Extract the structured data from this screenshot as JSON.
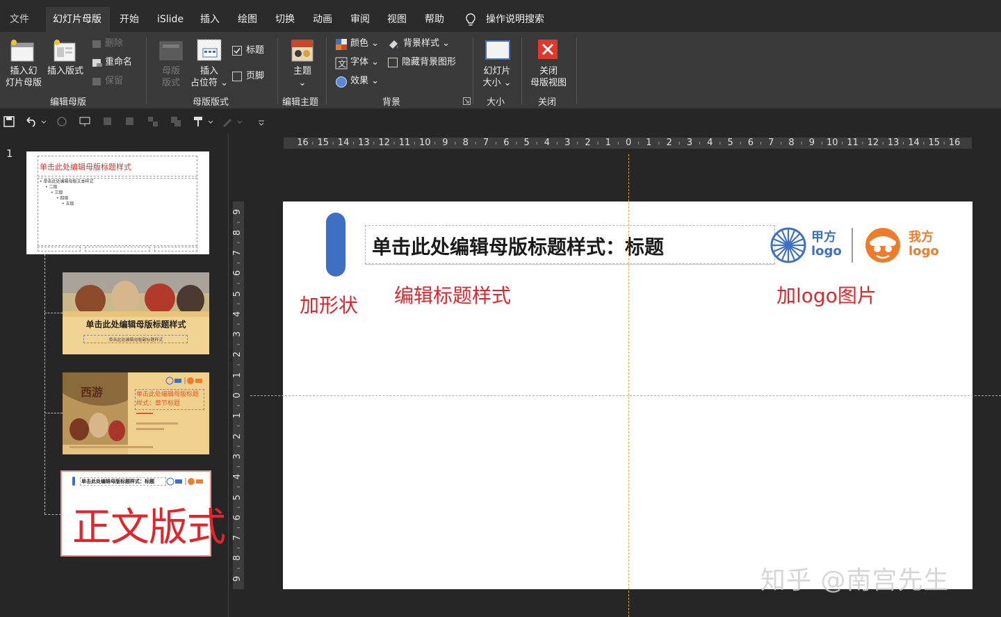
{
  "menu": {
    "tabs": [
      {
        "label": "文件"
      },
      {
        "label": "幻灯片母版"
      },
      {
        "label": "开始"
      },
      {
        "label": "iSlide"
      },
      {
        "label": "插入"
      },
      {
        "label": "绘图"
      },
      {
        "label": "切换"
      },
      {
        "label": "动画"
      },
      {
        "label": "审阅"
      },
      {
        "label": "视图"
      },
      {
        "label": "帮助"
      }
    ],
    "search_label": "操作说明搜索"
  },
  "ribbon": {
    "edit_master": {
      "insert_master_line1": "插入幻",
      "insert_master_line2": "灯片母版",
      "insert_layout": "插入版式",
      "delete": "删除",
      "rename": "重命名",
      "preserve": "保留",
      "group_label": "编辑母版"
    },
    "master_layout": {
      "master_layout_line1": "母版",
      "master_layout_line2": "版式",
      "insert_placeholder_line1": "插入",
      "insert_placeholder_line2": "占位符",
      "title_check": "标题",
      "footer_check": "页脚",
      "group_label": "母版版式"
    },
    "edit_theme": {
      "theme": "主题",
      "group_label": "编辑主题"
    },
    "background": {
      "colors": "颜色",
      "fonts": "字体",
      "effects": "效果",
      "bg_styles": "背景样式",
      "hide_bg": "隐藏背景图形",
      "group_label": "背景"
    },
    "size": {
      "slide_size_line1": "幻灯片",
      "slide_size_line2": "大小",
      "group_label": "大小"
    },
    "close": {
      "close_line1": "关闭",
      "close_line2": "母版视图",
      "group_label": "关闭"
    }
  },
  "thumbnails": {
    "slide_number": "1",
    "master_title": "单击此处编辑母版标题样式",
    "master_body": "• 单击此处编辑母版文本样式",
    "master_level2": "• 二级",
    "master_level3": "• 三级",
    "master_level4": "• 四级",
    "master_level5": "• 五级",
    "layout1_title": "单击此处编辑母版标题样式",
    "layout1_sub": "单击此处编辑母版副标题样式",
    "layout2_title": "单击此处编辑母版标题样式：章节标题",
    "layout3_title": "单击此处编辑母版标题样式：标题",
    "layout3_annotation": "正文版式"
  },
  "ruler": {
    "h_labels": [
      "16",
      "15",
      "14",
      "13",
      "12",
      "11",
      "10",
      "9",
      "8",
      "7",
      "6",
      "5",
      "4",
      "3",
      "2",
      "1",
      "0",
      "1",
      "2",
      "3",
      "4",
      "5",
      "6",
      "7",
      "8",
      "9",
      "10",
      "11",
      "12",
      "13",
      "14",
      "15",
      "16"
    ],
    "v_labels": [
      "9",
      "8",
      "7",
      "6",
      "5",
      "4",
      "3",
      "2",
      "1",
      "0",
      "1",
      "2",
      "3",
      "4",
      "5",
      "6",
      "7",
      "8",
      "9"
    ]
  },
  "slide": {
    "title": "单击此处编辑母版标题样式：标题",
    "anno_shape": "加形状",
    "anno_title": "编辑标题样式",
    "anno_logo": "加logo图片",
    "logo1_line1": "甲方",
    "logo1_line2": "logo",
    "logo2_line1": "我方",
    "logo2_line2": "logo",
    "colors": {
      "accent_blue": "#3f6fc2",
      "accent_orange": "#ee7d2b",
      "anno_red": "#e0262b"
    }
  },
  "watermark": "知乎 @南宫先生"
}
